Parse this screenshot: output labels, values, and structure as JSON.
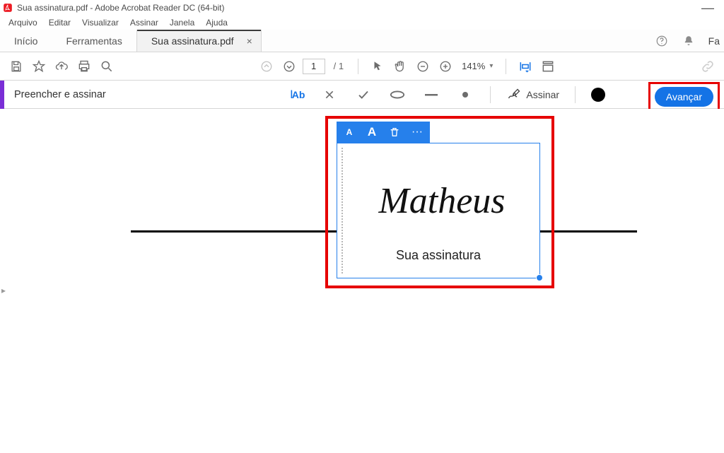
{
  "window": {
    "title": "Sua assinatura.pdf - Adobe Acrobat Reader DC (64-bit)"
  },
  "menu": {
    "file": "Arquivo",
    "edit": "Editar",
    "view": "Visualizar",
    "sign": "Assinar",
    "window": "Janela",
    "help": "Ajuda"
  },
  "tabs": {
    "home": "Início",
    "tools": "Ferramentas",
    "document": "Sua assinatura.pdf",
    "right_partial": "Fa"
  },
  "toolbar": {
    "page_current": "1",
    "page_total": "/ 1",
    "zoom": "141%"
  },
  "fillbar": {
    "title": "Preencher e assinar",
    "ab": "Ab",
    "sign": "Assinar",
    "advance": "Avançar"
  },
  "signature": {
    "toolbar_smallA": "A",
    "toolbar_bigA": "A",
    "toolbar_more": "···",
    "name": "Matheus",
    "label": "Sua assinatura"
  },
  "icons": {
    "app": "acrobat-icon",
    "min": "—"
  }
}
